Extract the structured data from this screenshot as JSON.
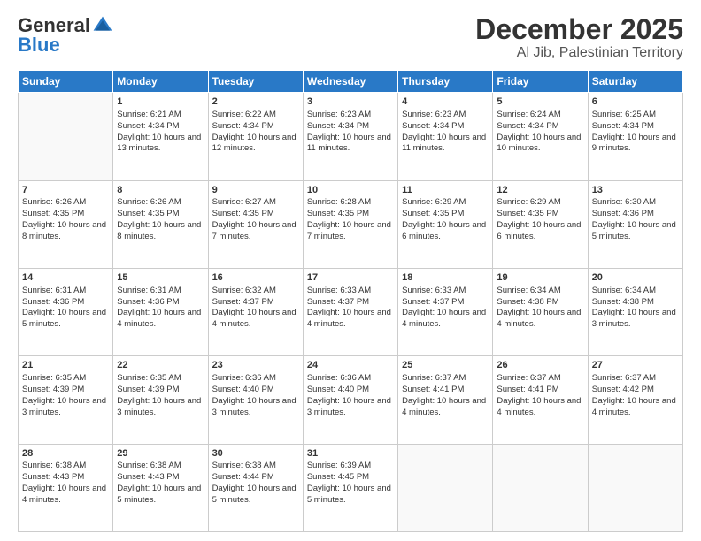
{
  "logo": {
    "general": "General",
    "blue": "Blue"
  },
  "title": "December 2025",
  "subtitle": "Al Jib, Palestinian Territory",
  "weekdays": [
    "Sunday",
    "Monday",
    "Tuesday",
    "Wednesday",
    "Thursday",
    "Friday",
    "Saturday"
  ],
  "weeks": [
    [
      {
        "day": "",
        "info": ""
      },
      {
        "day": "1",
        "info": "Sunrise: 6:21 AM\nSunset: 4:34 PM\nDaylight: 10 hours and 13 minutes."
      },
      {
        "day": "2",
        "info": "Sunrise: 6:22 AM\nSunset: 4:34 PM\nDaylight: 10 hours and 12 minutes."
      },
      {
        "day": "3",
        "info": "Sunrise: 6:23 AM\nSunset: 4:34 PM\nDaylight: 10 hours and 11 minutes."
      },
      {
        "day": "4",
        "info": "Sunrise: 6:23 AM\nSunset: 4:34 PM\nDaylight: 10 hours and 11 minutes."
      },
      {
        "day": "5",
        "info": "Sunrise: 6:24 AM\nSunset: 4:34 PM\nDaylight: 10 hours and 10 minutes."
      },
      {
        "day": "6",
        "info": "Sunrise: 6:25 AM\nSunset: 4:34 PM\nDaylight: 10 hours and 9 minutes."
      }
    ],
    [
      {
        "day": "7",
        "info": "Sunrise: 6:26 AM\nSunset: 4:35 PM\nDaylight: 10 hours and 8 minutes."
      },
      {
        "day": "8",
        "info": "Sunrise: 6:26 AM\nSunset: 4:35 PM\nDaylight: 10 hours and 8 minutes."
      },
      {
        "day": "9",
        "info": "Sunrise: 6:27 AM\nSunset: 4:35 PM\nDaylight: 10 hours and 7 minutes."
      },
      {
        "day": "10",
        "info": "Sunrise: 6:28 AM\nSunset: 4:35 PM\nDaylight: 10 hours and 7 minutes."
      },
      {
        "day": "11",
        "info": "Sunrise: 6:29 AM\nSunset: 4:35 PM\nDaylight: 10 hours and 6 minutes."
      },
      {
        "day": "12",
        "info": "Sunrise: 6:29 AM\nSunset: 4:35 PM\nDaylight: 10 hours and 6 minutes."
      },
      {
        "day": "13",
        "info": "Sunrise: 6:30 AM\nSunset: 4:36 PM\nDaylight: 10 hours and 5 minutes."
      }
    ],
    [
      {
        "day": "14",
        "info": "Sunrise: 6:31 AM\nSunset: 4:36 PM\nDaylight: 10 hours and 5 minutes."
      },
      {
        "day": "15",
        "info": "Sunrise: 6:31 AM\nSunset: 4:36 PM\nDaylight: 10 hours and 4 minutes."
      },
      {
        "day": "16",
        "info": "Sunrise: 6:32 AM\nSunset: 4:37 PM\nDaylight: 10 hours and 4 minutes."
      },
      {
        "day": "17",
        "info": "Sunrise: 6:33 AM\nSunset: 4:37 PM\nDaylight: 10 hours and 4 minutes."
      },
      {
        "day": "18",
        "info": "Sunrise: 6:33 AM\nSunset: 4:37 PM\nDaylight: 10 hours and 4 minutes."
      },
      {
        "day": "19",
        "info": "Sunrise: 6:34 AM\nSunset: 4:38 PM\nDaylight: 10 hours and 4 minutes."
      },
      {
        "day": "20",
        "info": "Sunrise: 6:34 AM\nSunset: 4:38 PM\nDaylight: 10 hours and 3 minutes."
      }
    ],
    [
      {
        "day": "21",
        "info": "Sunrise: 6:35 AM\nSunset: 4:39 PM\nDaylight: 10 hours and 3 minutes."
      },
      {
        "day": "22",
        "info": "Sunrise: 6:35 AM\nSunset: 4:39 PM\nDaylight: 10 hours and 3 minutes."
      },
      {
        "day": "23",
        "info": "Sunrise: 6:36 AM\nSunset: 4:40 PM\nDaylight: 10 hours and 3 minutes."
      },
      {
        "day": "24",
        "info": "Sunrise: 6:36 AM\nSunset: 4:40 PM\nDaylight: 10 hours and 3 minutes."
      },
      {
        "day": "25",
        "info": "Sunrise: 6:37 AM\nSunset: 4:41 PM\nDaylight: 10 hours and 4 minutes."
      },
      {
        "day": "26",
        "info": "Sunrise: 6:37 AM\nSunset: 4:41 PM\nDaylight: 10 hours and 4 minutes."
      },
      {
        "day": "27",
        "info": "Sunrise: 6:37 AM\nSunset: 4:42 PM\nDaylight: 10 hours and 4 minutes."
      }
    ],
    [
      {
        "day": "28",
        "info": "Sunrise: 6:38 AM\nSunset: 4:43 PM\nDaylight: 10 hours and 4 minutes."
      },
      {
        "day": "29",
        "info": "Sunrise: 6:38 AM\nSunset: 4:43 PM\nDaylight: 10 hours and 5 minutes."
      },
      {
        "day": "30",
        "info": "Sunrise: 6:38 AM\nSunset: 4:44 PM\nDaylight: 10 hours and 5 minutes."
      },
      {
        "day": "31",
        "info": "Sunrise: 6:39 AM\nSunset: 4:45 PM\nDaylight: 10 hours and 5 minutes."
      },
      {
        "day": "",
        "info": ""
      },
      {
        "day": "",
        "info": ""
      },
      {
        "day": "",
        "info": ""
      }
    ]
  ]
}
